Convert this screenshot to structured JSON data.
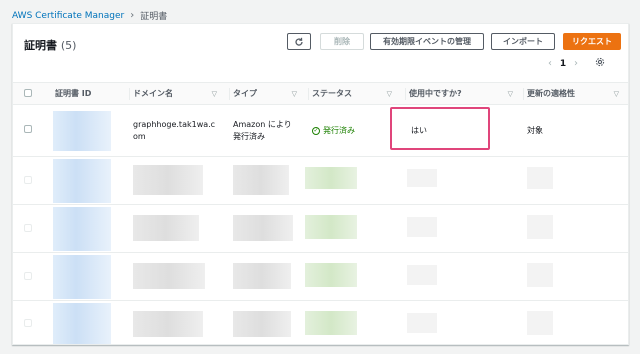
{
  "breadcrumb": {
    "service": "AWS Certificate Manager",
    "current": "証明書"
  },
  "panel": {
    "title": "証明書",
    "count": "(5)"
  },
  "toolbar": {
    "delete_label": "削除",
    "manage_expiry_label": "有効期限イベントの管理",
    "import_label": "インポート",
    "request_label": "リクエスト"
  },
  "pagination": {
    "page": "1"
  },
  "table": {
    "columns": [
      "証明書 ID",
      "ドメイン名",
      "タイプ",
      "ステータス",
      "使用中ですか?",
      "更新の適格性"
    ],
    "rows": [
      {
        "id": "",
        "domain_line1": "graphhoge.tak1wa.c",
        "domain_line2": "om",
        "type_line1": "Amazon により",
        "type_line2": "発行済み",
        "status": "発行済み",
        "in_use": "はい",
        "renewal": "対象"
      }
    ]
  },
  "colors": {
    "accent": "#ec7211",
    "link": "#0073bb",
    "success": "#1d8102",
    "highlight": "#e0457b"
  },
  "icons": [
    "refresh-icon",
    "chevron-right-icon",
    "chevron-left-icon",
    "settings-gear-icon",
    "sort-caret-icon",
    "check-circle-icon"
  ]
}
